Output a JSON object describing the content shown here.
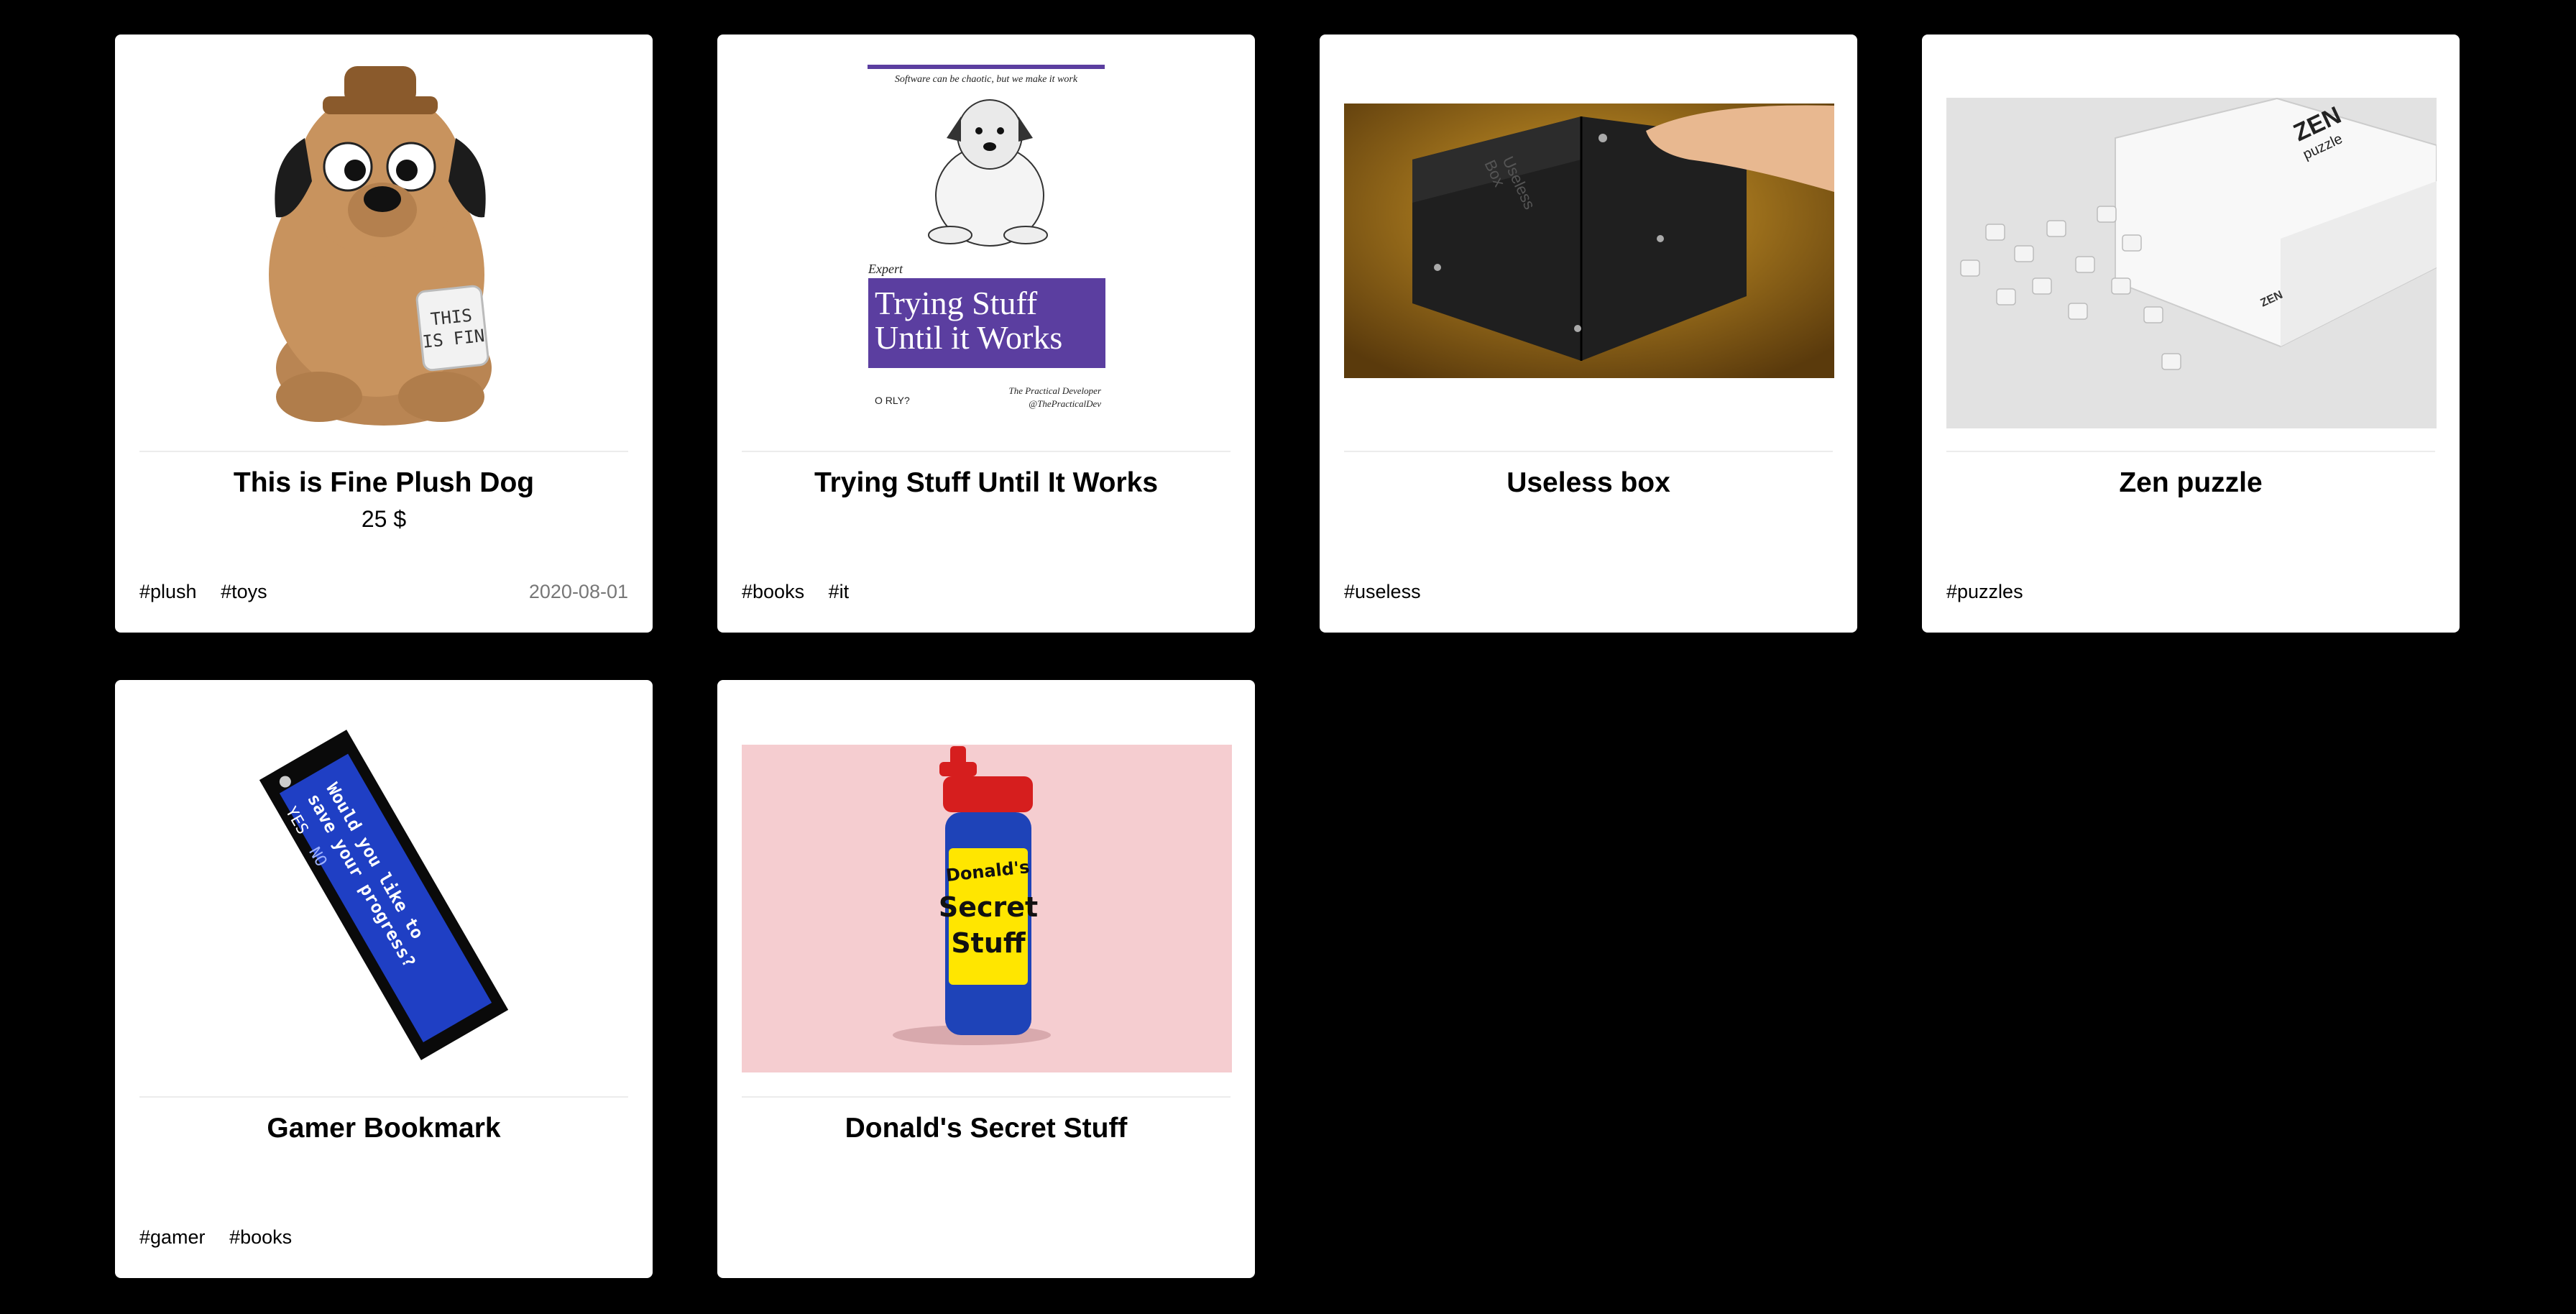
{
  "products": [
    {
      "title": "This is Fine Plush Dog",
      "price": "25 $",
      "tags": [
        "#plush",
        "#toys"
      ],
      "date": "2020-08-01",
      "mug_text": "THIS\nIS FIN"
    },
    {
      "title": "Trying Stuff Until It Works",
      "tags": [
        "#books",
        "#it"
      ],
      "cover": {
        "tagline": "Software can be chaotic, but we make it work",
        "kicker": "Expert",
        "heading": "Trying Stuff\nUntil it Works",
        "publisher": "O RLY?",
        "author": "The Practical Developer",
        "handle": "@ThePracticalDev"
      }
    },
    {
      "title": "Useless box",
      "tags": [
        "#useless"
      ],
      "box_label": "Useless\nBox"
    },
    {
      "title": "Zen puzzle",
      "tags": [
        "#puzzles"
      ],
      "box_brand": "ZEN",
      "box_word": "puzzle",
      "box_small": "ZEN"
    },
    {
      "title": "Gamer Bookmark",
      "tags": [
        "#gamer",
        "#books"
      ],
      "bookmark_text": "Would you like to\nsave your progress?",
      "bookmark_yes": "YES",
      "bookmark_no": "NO"
    },
    {
      "title": "Donald's Secret Stuff",
      "tags": [],
      "label_line1": "Donald's",
      "label_line2": "Secret\nStuff"
    }
  ]
}
